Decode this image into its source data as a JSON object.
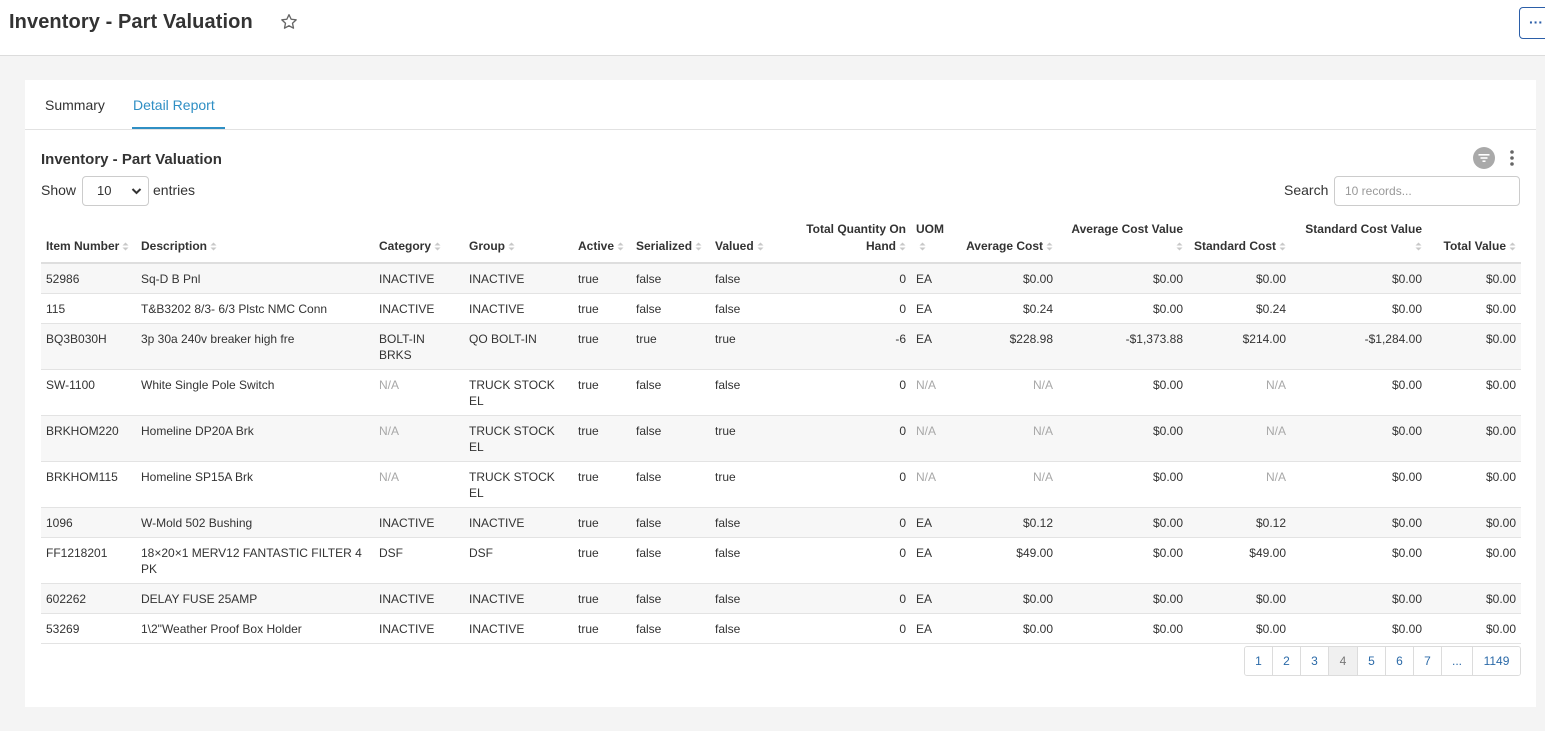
{
  "header": {
    "title": "Inventory - Part Valuation",
    "more_label": "···"
  },
  "tabs": [
    {
      "label": "Summary",
      "active": false
    },
    {
      "label": "Detail Report",
      "active": true
    }
  ],
  "report": {
    "title": "Inventory - Part Valuation",
    "show_label": "Show",
    "entries_value": "10",
    "entries_label": "entries",
    "search_label": "Search",
    "search_placeholder": "10 records..."
  },
  "table": {
    "columns": [
      {
        "label": "Item Number",
        "align": "left"
      },
      {
        "label": "Description",
        "align": "left"
      },
      {
        "label": "Category",
        "align": "left"
      },
      {
        "label": "Group",
        "align": "left"
      },
      {
        "label": "Active",
        "align": "left"
      },
      {
        "label": "Serialized",
        "align": "left"
      },
      {
        "label": "Valued",
        "align": "left"
      },
      {
        "label": "Total Quantity On Hand",
        "align": "right"
      },
      {
        "label": "UOM",
        "align": "left"
      },
      {
        "label": "Average Cost",
        "align": "right"
      },
      {
        "label": "Average Cost Value",
        "align": "right"
      },
      {
        "label": "Standard Cost",
        "align": "right"
      },
      {
        "label": "Standard Cost Value",
        "align": "right"
      },
      {
        "label": "Total Value",
        "align": "right"
      }
    ],
    "rows": [
      [
        "52986",
        "Sq-D B Pnl",
        "INACTIVE",
        "INACTIVE",
        "true",
        "false",
        "false",
        "0",
        "EA",
        "$0.00",
        "$0.00",
        "$0.00",
        "$0.00",
        "$0.00"
      ],
      [
        "115",
        "T&B3202 8/3- 6/3 Plstc NMC Conn",
        "INACTIVE",
        "INACTIVE",
        "true",
        "false",
        "false",
        "0",
        "EA",
        "$0.24",
        "$0.00",
        "$0.24",
        "$0.00",
        "$0.00"
      ],
      [
        "BQ3B030H",
        "3p 30a 240v breaker high fre",
        "BOLT-IN BRKS",
        "QO BOLT-IN",
        "true",
        "true",
        "true",
        "-6",
        "EA",
        "$228.98",
        "-$1,373.88",
        "$214.00",
        "-$1,284.00",
        "$0.00"
      ],
      [
        "SW-1100",
        "White Single Pole Switch",
        "N/A",
        "TRUCK STOCK EL",
        "true",
        "false",
        "false",
        "0",
        "N/A",
        "N/A",
        "$0.00",
        "N/A",
        "$0.00",
        "$0.00"
      ],
      [
        "BRKHOM220",
        "Homeline DP20A Brk",
        "N/A",
        "TRUCK STOCK EL",
        "true",
        "false",
        "true",
        "0",
        "N/A",
        "N/A",
        "$0.00",
        "N/A",
        "$0.00",
        "$0.00"
      ],
      [
        "BRKHOM115",
        "Homeline SP15A Brk",
        "N/A",
        "TRUCK STOCK EL",
        "true",
        "false",
        "true",
        "0",
        "N/A",
        "N/A",
        "$0.00",
        "N/A",
        "$0.00",
        "$0.00"
      ],
      [
        "1096",
        "W-Mold 502 Bushing",
        "INACTIVE",
        "INACTIVE",
        "true",
        "false",
        "false",
        "0",
        "EA",
        "$0.12",
        "$0.00",
        "$0.12",
        "$0.00",
        "$0.00"
      ],
      [
        "FF1218201",
        "18×20×1 MERV12 FANTASTIC FILTER 4 PK",
        "DSF",
        "DSF",
        "true",
        "false",
        "false",
        "0",
        "EA",
        "$49.00",
        "$0.00",
        "$49.00",
        "$0.00",
        "$0.00"
      ],
      [
        "602262",
        "DELAY FUSE 25AMP",
        "INACTIVE",
        "INACTIVE",
        "true",
        "false",
        "false",
        "0",
        "EA",
        "$0.00",
        "$0.00",
        "$0.00",
        "$0.00",
        "$0.00"
      ],
      [
        "53269",
        "1\\2\"Weather Proof Box Holder",
        "INACTIVE",
        "INACTIVE",
        "true",
        "false",
        "false",
        "0",
        "EA",
        "$0.00",
        "$0.00",
        "$0.00",
        "$0.00",
        "$0.00"
      ]
    ]
  },
  "pagination": {
    "pages": [
      "1",
      "2",
      "3",
      "4",
      "5",
      "6",
      "7",
      "...",
      "1149"
    ],
    "active": "4"
  },
  "colors": {
    "accent": "#2f8fc4",
    "link": "#2b6aa8",
    "muted": "#a8a8a8"
  }
}
